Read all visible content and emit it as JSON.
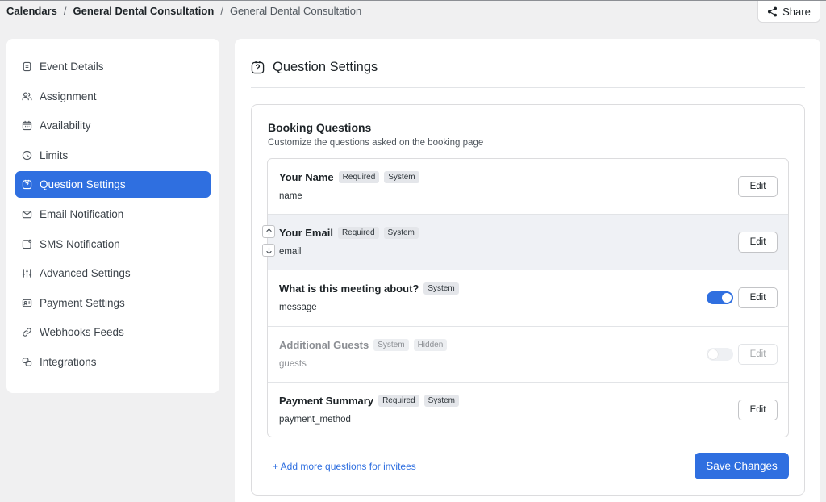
{
  "breadcrumb": {
    "root": "Calendars",
    "parent": "General Dental Consultation",
    "current": "General Dental Consultation",
    "separator": "/"
  },
  "share_label": "Share",
  "sidebar": {
    "items": [
      {
        "label": "Event Details",
        "icon": "document-icon"
      },
      {
        "label": "Assignment",
        "icon": "users-icon"
      },
      {
        "label": "Availability",
        "icon": "calendar-icon"
      },
      {
        "label": "Limits",
        "icon": "clock-icon"
      },
      {
        "label": "Question Settings",
        "icon": "question-icon",
        "active": true
      },
      {
        "label": "Email Notification",
        "icon": "mail-icon"
      },
      {
        "label": "SMS Notification",
        "icon": "sms-icon"
      },
      {
        "label": "Advanced Settings",
        "icon": "sliders-icon"
      },
      {
        "label": "Payment Settings",
        "icon": "payment-icon"
      },
      {
        "label": "Webhooks Feeds",
        "icon": "link-icon"
      },
      {
        "label": "Integrations",
        "icon": "integrations-icon"
      }
    ]
  },
  "main": {
    "title": "Question Settings",
    "card_title": "Booking Questions",
    "card_subtitle": "Customize the questions asked on the booking page",
    "questions": [
      {
        "name": "Your Name",
        "key": "name",
        "badges": [
          "Required",
          "System"
        ],
        "edit": "Edit"
      },
      {
        "name": "Your Email",
        "key": "email",
        "badges": [
          "Required",
          "System"
        ],
        "edit": "Edit"
      },
      {
        "name": "What is this meeting about?",
        "key": "message",
        "badges": [
          "System"
        ],
        "edit": "Edit",
        "toggle": "on"
      },
      {
        "name": "Additional Guests",
        "key": "guests",
        "badges": [
          "System",
          "Hidden"
        ],
        "edit": "Edit",
        "toggle": "off"
      },
      {
        "name": "Payment Summary",
        "key": "payment_method",
        "badges": [
          "Required",
          "System"
        ],
        "edit": "Edit"
      }
    ],
    "add_more": "+ Add more questions for invitees",
    "save_label": "Save Changes"
  },
  "colors": {
    "accent": "#2f6fe0",
    "background": "#f0f0f1"
  }
}
